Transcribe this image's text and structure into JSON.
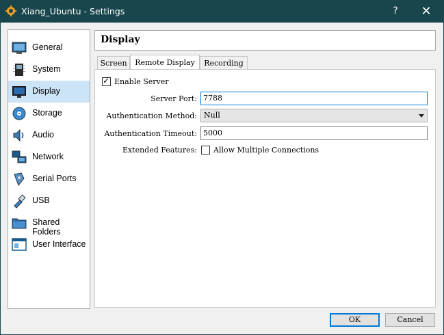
{
  "window": {
    "title": "Xiang_Ubuntu - Settings",
    "help_glyph": "?",
    "close_glyph": "✕"
  },
  "sidebar": {
    "items": [
      {
        "label": "General",
        "icon": "general-icon"
      },
      {
        "label": "System",
        "icon": "system-icon"
      },
      {
        "label": "Display",
        "icon": "display-icon",
        "selected": true
      },
      {
        "label": "Storage",
        "icon": "storage-icon"
      },
      {
        "label": "Audio",
        "icon": "audio-icon"
      },
      {
        "label": "Network",
        "icon": "network-icon"
      },
      {
        "label": "Serial Ports",
        "icon": "serial-ports-icon"
      },
      {
        "label": "USB",
        "icon": "usb-icon"
      },
      {
        "label": "Shared Folders",
        "icon": "shared-folders-icon"
      },
      {
        "label": "User Interface",
        "icon": "user-interface-icon"
      }
    ]
  },
  "page": {
    "title": "Display"
  },
  "tabs": [
    {
      "label": "Screen"
    },
    {
      "label": "Remote Display",
      "active": true
    },
    {
      "label": "Recording"
    }
  ],
  "remote_display": {
    "enable_server": {
      "label": "Enable Server",
      "checked": true
    },
    "server_port": {
      "label": "Server Port:",
      "value": "7788"
    },
    "auth_method": {
      "label": "Authentication Method:",
      "value": "Null"
    },
    "auth_timeout": {
      "label": "Authentication Timeout:",
      "value": "5000"
    },
    "extended_features": {
      "label": "Extended Features:",
      "allow_multiple": {
        "label": "Allow Multiple Connections",
        "checked": false
      }
    }
  },
  "buttons": {
    "ok": "OK",
    "cancel": "Cancel"
  },
  "colors": {
    "titlebar": "#18464c",
    "selection": "#cce4f7",
    "focus": "#0078d7"
  }
}
